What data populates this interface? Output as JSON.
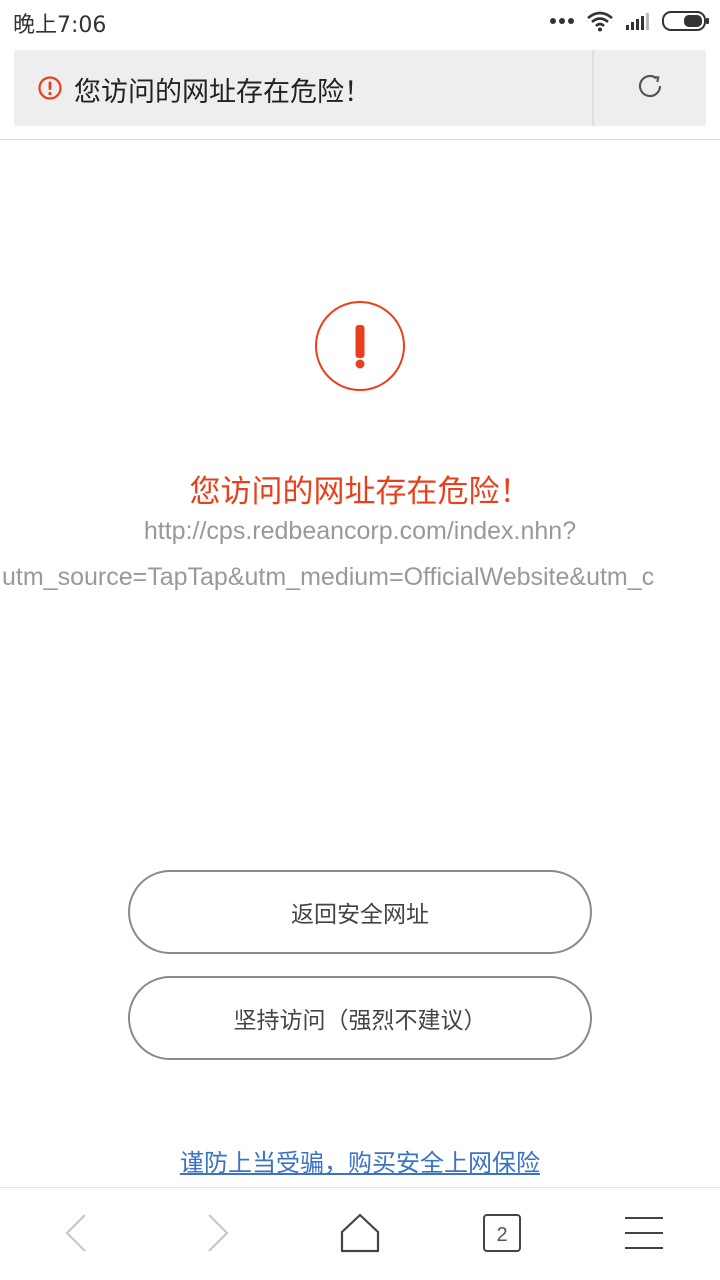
{
  "status_bar": {
    "time": "晚上7:06",
    "icons": [
      "more-dots-icon",
      "wifi-icon",
      "signal-icon",
      "battery-icon"
    ]
  },
  "address_bar": {
    "warning_icon": "alert-circle-icon",
    "text": "您访问的网址存在危险！",
    "reload_icon": "reload-icon"
  },
  "warning": {
    "icon": "alert-circle-icon",
    "title": "您访问的网址存在危险！",
    "url_line_1": "http://cps.redbeancorp.com/index.nhn?",
    "url_line_2": "utm_source=TapTap&utm_medium=OfficialWebsite&utm_c"
  },
  "actions": {
    "back_label": "返回安全网址",
    "continue_label": "坚持访问（强烈不建议）",
    "insurance_link": "谨防上当受骗，购买安全上网保险"
  },
  "bottom_nav": {
    "items": [
      "back-icon",
      "forward-icon",
      "home-icon",
      "tabs-icon",
      "menu-icon"
    ],
    "tab_count": "2"
  },
  "colors": {
    "danger": "#e8401c",
    "link": "#3a72c8",
    "muted_text": "#999999",
    "address_bg": "#eeeeee"
  }
}
